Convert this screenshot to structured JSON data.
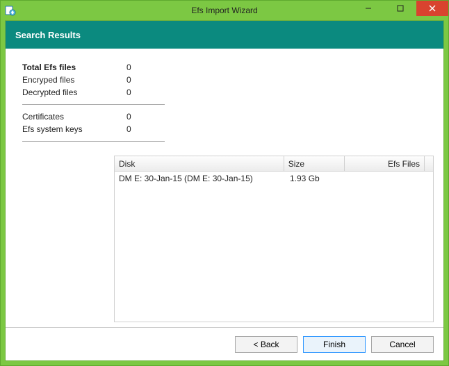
{
  "window": {
    "title": "Efs Import Wizard",
    "icon": "app-icon"
  },
  "header": {
    "title": "Search Results"
  },
  "stats": {
    "total_label": "Total Efs files",
    "total_value": "0",
    "encrypted_label": "Encryped files",
    "encrypted_value": "0",
    "decrypted_label": "Decrypted files",
    "decrypted_value": "0",
    "certs_label": "Certificates",
    "certs_value": "0",
    "syskeys_label": "Efs system keys",
    "syskeys_value": "0"
  },
  "table": {
    "headers": {
      "disk": "Disk",
      "size": "Size",
      "efs": "Efs Files"
    },
    "rows": [
      {
        "disk": "DM E: 30-Jan-15 (DM E: 30-Jan-15)",
        "size": "1.93 Gb",
        "efs": ""
      }
    ]
  },
  "footer": {
    "back": "< Back",
    "finish": "Finish",
    "cancel": "Cancel"
  }
}
